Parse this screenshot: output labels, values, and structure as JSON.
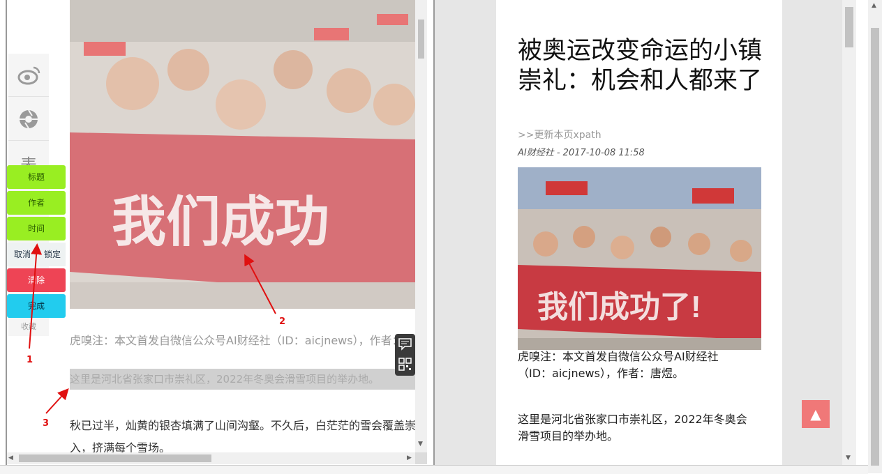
{
  "colors": {
    "selected_green": "#99ee22",
    "clear_red": "#ee4455",
    "done_cyan": "#22ccee",
    "back_top": "#f07878",
    "annotation_red": "#e01010"
  },
  "left": {
    "share_icons": [
      "weibo-icon",
      "camera-shutter-icon",
      "share-char-icon"
    ],
    "share_char": "表",
    "collect_label": "收藏",
    "buttons": {
      "title": "标题",
      "author": "作者",
      "time": "时间",
      "cancel": "取消",
      "lock": "锁定",
      "clear": "清除",
      "done": "完成"
    },
    "banner_text": "我们成功",
    "para_note": "虎嗅注：本文首发自微信公众号AI财经社（ID：aicjnews），作者：唐",
    "para_intro": "这里是河北省张家口市崇礼区，2022年冬奥会滑雪项目的举办地。",
    "para_autumn_1": "秋已过半，灿黄的银杏填满了山间沟壑。不久后，白茫茫的雪会覆盖崇",
    "para_autumn_2": "入，挤满每个雪场。"
  },
  "annotations": {
    "one": "1",
    "two": "2",
    "three": "3"
  },
  "right": {
    "title": "被奥运改变命运的小镇崇礼：机会和人都来了",
    "update_link": ">>更新本页xpath",
    "byline": "AI财经社 - 2017-10-08 11:58",
    "banner_text": "我们成功了!",
    "note_line1": "虎嗅注：本文首发自微信公众号AI财经社",
    "note_line2": "（ID：aicjnews），作者：唐煜。",
    "intro_line1": "这里是河北省张家口市崇礼区，2022年冬奥会",
    "intro_line2": "滑雪项目的举办地。",
    "back_top_glyph": "▲"
  }
}
